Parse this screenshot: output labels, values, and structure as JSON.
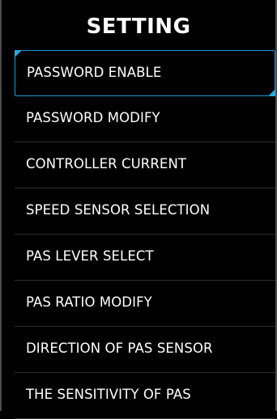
{
  "header": {
    "title": "SETTING"
  },
  "menu": {
    "selected_index": 0,
    "items": [
      {
        "label": "PASSWORD ENABLE"
      },
      {
        "label": "PASSWORD MODIFY"
      },
      {
        "label": "CONTROLLER CURRENT"
      },
      {
        "label": "SPEED SENSOR SELECTION"
      },
      {
        "label": "PAS LEVER SELECT"
      },
      {
        "label": "PAS RATIO MODIFY"
      },
      {
        "label": "DIRECTION OF PAS SENSOR"
      },
      {
        "label": "THE SENSITIVITY OF PAS"
      }
    ]
  },
  "colors": {
    "background": "#000000",
    "text": "#ffffff",
    "accent": "#1f9bd8",
    "divider": "#2e2e2e"
  }
}
